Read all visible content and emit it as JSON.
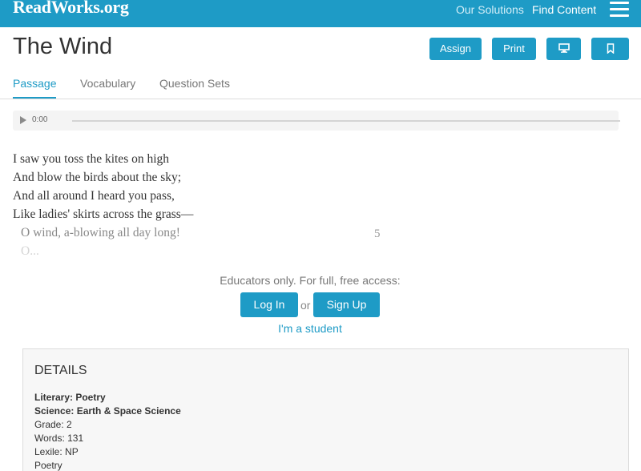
{
  "header": {
    "logo": "ReadWorks.org",
    "nav": [
      "Our Solutions",
      "Find Content"
    ],
    "menu_icon": "hamburger-icon"
  },
  "title": "The Wind",
  "actions": {
    "assign": "Assign",
    "print": "Print",
    "present_icon": "monitor-icon",
    "bookmark_icon": "bookmark-icon"
  },
  "tabs": [
    "Passage",
    "Vocabulary",
    "Question Sets"
  ],
  "active_tab": "Passage",
  "audio": {
    "time": "0:00",
    "play_icon": "play-icon"
  },
  "poem": {
    "lines": [
      "I saw you toss the kites on high",
      "And blow the birds about the sky;",
      "And all around I heard you pass,",
      "Like ladies' skirts across the grass—",
      "O wind, a-blowing all day long!",
      "O..."
    ],
    "line_number": "5"
  },
  "gate": {
    "message": "Educators only. For full, free access:",
    "login": "Log In",
    "or": "or",
    "signup": "Sign Up",
    "student": "I'm a student"
  },
  "details": {
    "title": "DETAILS",
    "items": [
      "Literary: Poetry",
      "Science: Earth & Space Science",
      "Grade: 2",
      "Words: 131",
      "Lexile: NP",
      "Poetry"
    ]
  },
  "colors": {
    "brand": "#1e9bc6"
  }
}
